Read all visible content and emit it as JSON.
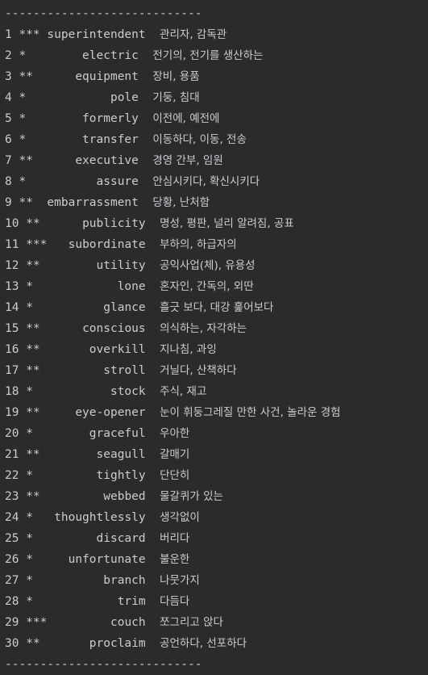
{
  "console": {
    "separator_top": "----------------------------",
    "separator_bottom": "----------------------------",
    "rows": [
      {
        "num": "1",
        "stars": "***",
        "word": "superintendent",
        "meaning": "관리자, 감독관"
      },
      {
        "num": "2",
        "stars": "*",
        "word": "electric",
        "meaning": "전기의, 전기를 생산하는"
      },
      {
        "num": "3",
        "stars": "**",
        "word": "equipment",
        "meaning": "장비, 용품"
      },
      {
        "num": "4",
        "stars": "*",
        "word": "pole",
        "meaning": "기둥, 침대"
      },
      {
        "num": "5",
        "stars": "*",
        "word": "formerly",
        "meaning": "이전에, 예전에"
      },
      {
        "num": "6",
        "stars": "*",
        "word": "transfer",
        "meaning": "이동하다, 이동, 전송"
      },
      {
        "num": "7",
        "stars": "**",
        "word": "executive",
        "meaning": "경영 간부, 임원"
      },
      {
        "num": "8",
        "stars": "*",
        "word": "assure",
        "meaning": "안심시키다, 확신시키다"
      },
      {
        "num": "9",
        "stars": "**",
        "word": "embarrassment",
        "meaning": "당황, 난처함"
      },
      {
        "num": "10",
        "stars": "**",
        "word": "publicity",
        "meaning": "명성, 평판, 널리 알려짐, 공표"
      },
      {
        "num": "11",
        "stars": "***",
        "word": "subordinate",
        "meaning": "부하의, 하급자의"
      },
      {
        "num": "12",
        "stars": "**",
        "word": "utility",
        "meaning": "공익사업(체), 유용성"
      },
      {
        "num": "13",
        "stars": "*",
        "word": "lone",
        "meaning": "혼자인, 간독의, 외딴"
      },
      {
        "num": "14",
        "stars": "*",
        "word": "glance",
        "meaning": "흘긋 보다, 대강 훑어보다"
      },
      {
        "num": "15",
        "stars": "**",
        "word": "conscious",
        "meaning": "의식하는, 자각하는"
      },
      {
        "num": "16",
        "stars": "**",
        "word": "overkill",
        "meaning": "지나침, 과잉"
      },
      {
        "num": "17",
        "stars": "**",
        "word": "stroll",
        "meaning": "거닐다, 산책하다"
      },
      {
        "num": "18",
        "stars": "*",
        "word": "stock",
        "meaning": "주식, 재고"
      },
      {
        "num": "19",
        "stars": "**",
        "word": "eye-opener",
        "meaning": "눈이 휘둥그레질 만한 사건, 놀라운 경험"
      },
      {
        "num": "20",
        "stars": "*",
        "word": "graceful",
        "meaning": "우아한"
      },
      {
        "num": "21",
        "stars": "**",
        "word": "seagull",
        "meaning": "갈매기"
      },
      {
        "num": "22",
        "stars": "*",
        "word": "tightly",
        "meaning": "단단히"
      },
      {
        "num": "23",
        "stars": "**",
        "word": "webbed",
        "meaning": "물갈퀴가 있는"
      },
      {
        "num": "24",
        "stars": "*",
        "word": "thoughtlessly",
        "meaning": "생각없이"
      },
      {
        "num": "25",
        "stars": "*",
        "word": "discard",
        "meaning": "버리다"
      },
      {
        "num": "26",
        "stars": "*",
        "word": "unfortunate",
        "meaning": "불운한"
      },
      {
        "num": "27",
        "stars": "*",
        "word": "branch",
        "meaning": "나뭇가지"
      },
      {
        "num": "28",
        "stars": "*",
        "word": "trim",
        "meaning": "다듬다"
      },
      {
        "num": "29",
        "stars": "***",
        "word": "couch",
        "meaning": "쪼그리고 앉다"
      },
      {
        "num": "30",
        "stars": "**",
        "word": "proclaim",
        "meaning": "공언하다, 선포하다"
      }
    ]
  }
}
